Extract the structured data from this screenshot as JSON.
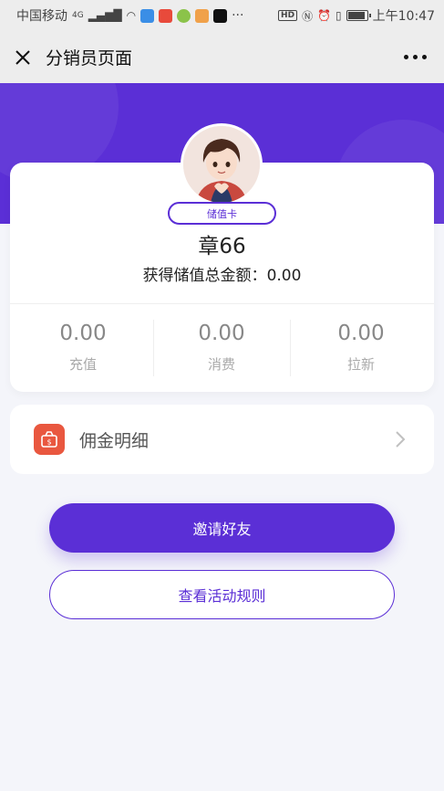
{
  "status_bar": {
    "carrier": "中国移动",
    "network": "4G",
    "time": "上午10:47",
    "hd": "HD",
    "more": "···"
  },
  "nav": {
    "title": "分销员页面"
  },
  "profile": {
    "badge": "储值卡",
    "name": "章66",
    "total_label": "获得储值总金额：",
    "total_value": "0.00"
  },
  "stats": [
    {
      "value": "0.00",
      "label": "充值"
    },
    {
      "value": "0.00",
      "label": "消费"
    },
    {
      "value": "0.00",
      "label": "拉新"
    }
  ],
  "commission": {
    "label": "佣金明细",
    "icon": "money-bag-icon"
  },
  "buttons": {
    "invite": "邀请好友",
    "rules": "查看活动规则"
  },
  "colors": {
    "primary": "#5b2fd6",
    "background": "#f4f5fa",
    "icon_red": "#e9573f"
  }
}
